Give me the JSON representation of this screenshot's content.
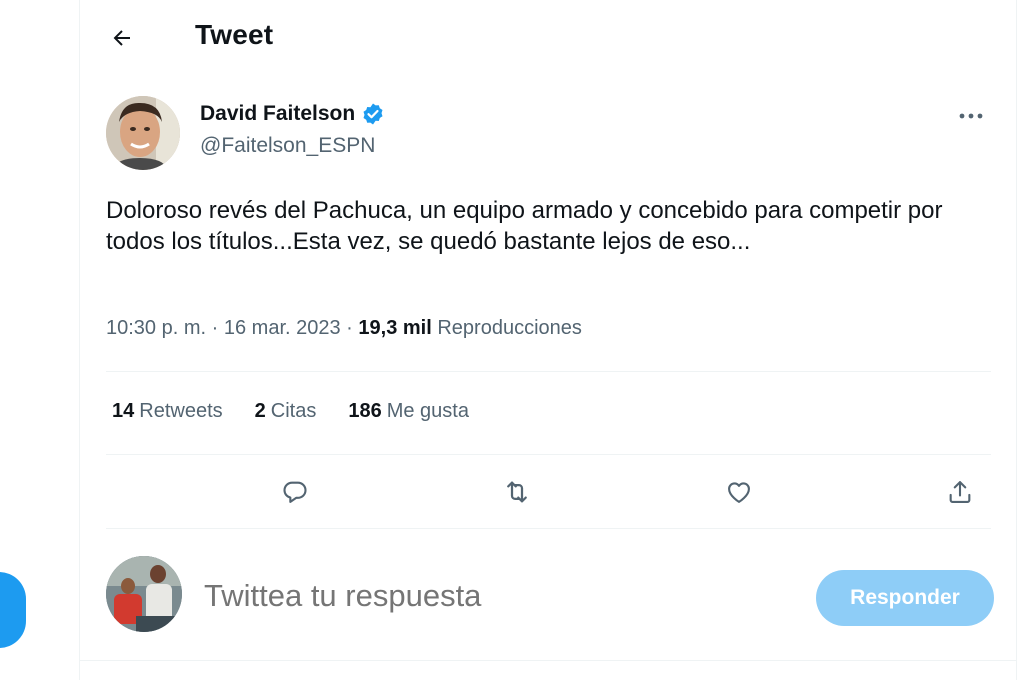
{
  "header": {
    "title": "Tweet"
  },
  "tweet": {
    "author_name": "David Faitelson",
    "author_handle": "@Faitelson_ESPN",
    "text": "Doloroso revés del Pachuca, un equipo armado y concebido para competir por todos los títulos...Esta vez, se quedó bastante lejos de eso...",
    "time": "10:30 p. m.",
    "date": "16 mar. 2023",
    "views_count": "19,3 mil",
    "views_label": "Reproducciones",
    "separator": "·"
  },
  "stats": {
    "retweets_count": "14",
    "retweets_label": "Retweets",
    "quotes_count": "2",
    "quotes_label": "Citas",
    "likes_count": "186",
    "likes_label": "Me gusta"
  },
  "reply": {
    "placeholder": "Twittea tu respuesta",
    "button_label": "Responder"
  },
  "colors": {
    "accent": "#1d9bf0",
    "reply_button_disabled": "#8ecdf7",
    "secondary_text": "#536471",
    "primary_text": "#0f1419",
    "divider": "#eff3f4"
  },
  "icons": [
    "back-arrow-icon",
    "verified-badge-icon",
    "more-icon",
    "reply-icon",
    "retweet-icon",
    "like-icon",
    "share-icon"
  ]
}
